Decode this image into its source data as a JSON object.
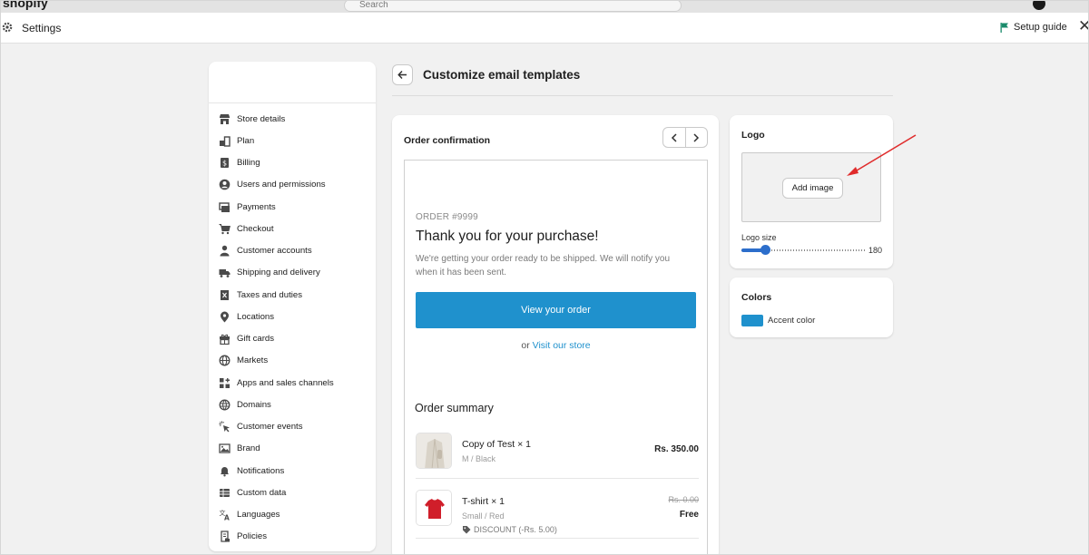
{
  "topbar": {
    "brand": "shopify",
    "search_placeholder": "Search"
  },
  "header": {
    "title": "Settings",
    "setup_guide": "Setup guide"
  },
  "sidebar": {
    "items": [
      {
        "label": "Store details",
        "icon": "store-icon"
      },
      {
        "label": "Plan",
        "icon": "plan-icon"
      },
      {
        "label": "Billing",
        "icon": "billing-icon"
      },
      {
        "label": "Users and permissions",
        "icon": "user-circle-icon"
      },
      {
        "label": "Payments",
        "icon": "payments-icon"
      },
      {
        "label": "Checkout",
        "icon": "cart-icon"
      },
      {
        "label": "Customer accounts",
        "icon": "person-icon"
      },
      {
        "label": "Shipping and delivery",
        "icon": "truck-icon"
      },
      {
        "label": "Taxes and duties",
        "icon": "receipt-icon"
      },
      {
        "label": "Locations",
        "icon": "location-pin-icon"
      },
      {
        "label": "Gift cards",
        "icon": "gift-icon"
      },
      {
        "label": "Markets",
        "icon": "globe-icon"
      },
      {
        "label": "Apps and sales channels",
        "icon": "apps-icon"
      },
      {
        "label": "Domains",
        "icon": "domain-globe-icon"
      },
      {
        "label": "Customer events",
        "icon": "cursor-click-icon"
      },
      {
        "label": "Brand",
        "icon": "brand-icon"
      },
      {
        "label": "Notifications",
        "icon": "bell-icon"
      },
      {
        "label": "Custom data",
        "icon": "custom-data-icon"
      },
      {
        "label": "Languages",
        "icon": "language-icon"
      },
      {
        "label": "Policies",
        "icon": "policy-icon"
      }
    ]
  },
  "page": {
    "title": "Customize email templates"
  },
  "preview": {
    "title": "Order confirmation",
    "order_number": "ORDER #9999",
    "heading": "Thank you for your purchase!",
    "body": "We're getting your order ready to be shipped. We will notify you when it has been sent.",
    "view_order": "View your order",
    "or_text": "or",
    "visit_store": "Visit our store",
    "summary_title": "Order summary",
    "items": [
      {
        "name": "Copy of Test × 1",
        "variant": "M / Black",
        "price": "Rs. 350.00"
      },
      {
        "name": "T-shirt × 1",
        "variant": "Small / Red",
        "discount": "DISCOUNT (-Rs. 5.00)",
        "old_price": "Rs. 0.00",
        "price": "Free"
      }
    ]
  },
  "logo": {
    "title": "Logo",
    "add_image": "Add image",
    "size_label": "Logo size",
    "size_value": "180",
    "slider_fraction": 0.19
  },
  "colors": {
    "title": "Colors",
    "accent_label": "Accent color",
    "accent_hex": "#1f91cd"
  }
}
